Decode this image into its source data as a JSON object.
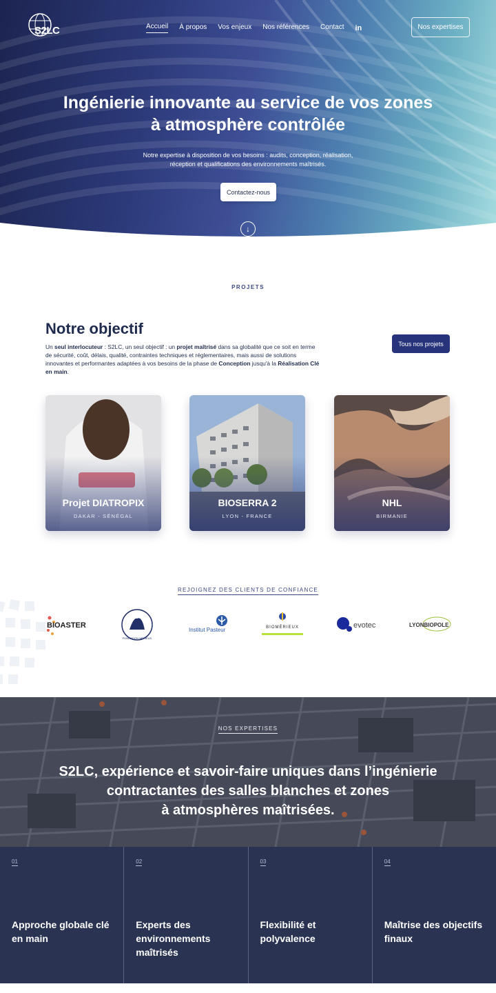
{
  "brand": {
    "logo_text": "S2LC"
  },
  "nav": {
    "items": [
      "Accueil",
      "À propos",
      "Vos enjeux",
      "Nos références",
      "Contact"
    ],
    "linkedin": "in",
    "cta": "Nos expertises"
  },
  "hero": {
    "title_line1": "Ingénierie innovante au service de vos zones",
    "title_line2": "à atmosphère contrôlée",
    "subtitle_line1": "Notre expertise à disposition de vos besoins : audits, conception, réalisation,",
    "subtitle_line2": "réception et qualifications des environnements maîtrisés.",
    "cta": "Contactez-nous"
  },
  "projects": {
    "eyebrow": "PROJETS",
    "title": "Notre objectif",
    "text_parts": {
      "p1": "Un ",
      "b1": "seul interlocuteur",
      "p2": " : S2LC, un seul objectif : un ",
      "b2": "projet maîtrisé",
      "p3": " dans sa globalité que ce soit en terme de sécurité, coût, délais, qualité, contraintes techniques et réglementaires, mais aussi de solutions innovantes et performantes adaptées à vos besoins de la phase de ",
      "b3": "Conception",
      "p4": " jusqu'à la ",
      "b4": "Réalisation Clé en main",
      "p5": "."
    },
    "cta": "Tous nos projets",
    "cards": [
      {
        "title": "Projet DIATROPIX",
        "location": "DAKAR - SÉNÉGAL"
      },
      {
        "title": "BIOSERRA 2",
        "location": "LYON - FRANCE"
      },
      {
        "title": "NHL",
        "location": "BIRMANIE"
      }
    ]
  },
  "clients": {
    "label": "REJOIGNEZ DES CLIENTS DE CONFIANCE",
    "logos": [
      "BIOASTER",
      "FONDATION MÉRIEUX",
      "Institut Pasteur",
      "BIOMÉRIEUX",
      "evotec",
      "LYONBIOPOLE"
    ]
  },
  "expertises": {
    "label": "NOS EXPERTISES",
    "title_line1": "S2LC, expérience et savoir-faire uniques dans l’ingénierie",
    "title_line2": "contractantes des salles blanches et zones",
    "title_line3": "à atmosphères maîtrisées.",
    "items": [
      {
        "num": "01",
        "title": "Approche globale clé en main"
      },
      {
        "num": "02",
        "title": "Experts des environnements maîtrisés"
      },
      {
        "num": "03",
        "title": "Flexibilité et polyvalence"
      },
      {
        "num": "04",
        "title": "Maîtrise des objectifs finaux"
      }
    ]
  },
  "colors": {
    "navy": "#27337a",
    "dark_band": "#2a3452",
    "text": "#1f2b4d"
  }
}
